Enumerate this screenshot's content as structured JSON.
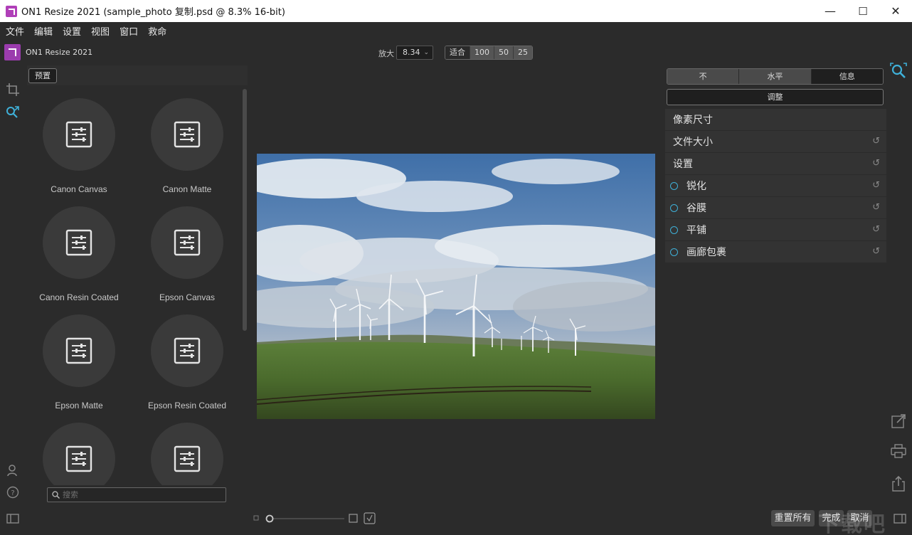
{
  "window": {
    "title": "ON1 Resize 2021 (sample_photo 复制.psd @ 8.3% 16-bit)",
    "minimize": "—",
    "maximize": "☐",
    "close": "✕"
  },
  "menu": [
    "文件",
    "编辑",
    "设置",
    "视图",
    "窗口",
    "救命"
  ],
  "brand": {
    "name": "ON1 Resize 2021"
  },
  "zoom": {
    "label": "放大",
    "value": "8.34",
    "buttons": [
      "适合",
      "100",
      "50",
      "25"
    ]
  },
  "presets": {
    "tab_label": "预置",
    "items": [
      {
        "label": "Canon Canvas"
      },
      {
        "label": "Canon Matte"
      },
      {
        "label": "Canon Resin Coated"
      },
      {
        "label": "Epson Canvas"
      },
      {
        "label": "Epson Matte"
      },
      {
        "label": "Epson Resin Coated"
      },
      {
        "label": ""
      },
      {
        "label": ""
      }
    ],
    "search_placeholder": "搜索"
  },
  "right_panel": {
    "segments": [
      {
        "label": "不",
        "active": false
      },
      {
        "label": "水平",
        "active": false
      },
      {
        "label": "信息",
        "active": true
      }
    ],
    "adjust_label": "调整",
    "sections": [
      {
        "label": "像素尺寸",
        "radio": false,
        "reset": false
      },
      {
        "label": "文件大小",
        "radio": false,
        "reset": true
      },
      {
        "label": "设置",
        "radio": false,
        "reset": true
      },
      {
        "label": "锐化",
        "radio": true,
        "reset": true
      },
      {
        "label": "谷膜",
        "radio": true,
        "reset": true
      },
      {
        "label": "平铺",
        "radio": true,
        "reset": true
      },
      {
        "label": "画廊包裹",
        "radio": true,
        "reset": true
      }
    ]
  },
  "footer": {
    "reset_all": "重置所有",
    "done": "完成",
    "cancel": "取消"
  },
  "watermark": "下载吧",
  "colors": {
    "accent": "#3fb0d8",
    "brand": "#9b3cae",
    "panel": "#333333",
    "background": "#2b2b2b"
  },
  "icons": {
    "crop": "crop-icon",
    "resize_tool": "resize-tool-icon",
    "user": "user-icon",
    "help": "help-icon",
    "panel_toggle": "panel-toggle-icon",
    "zoom_inspect": "zoom-inspect-icon",
    "open_in": "open-in-icon",
    "print": "print-icon",
    "export": "export-icon",
    "preset": "preset-sliders-icon",
    "search": "search-icon",
    "reset": "reset-icon"
  }
}
